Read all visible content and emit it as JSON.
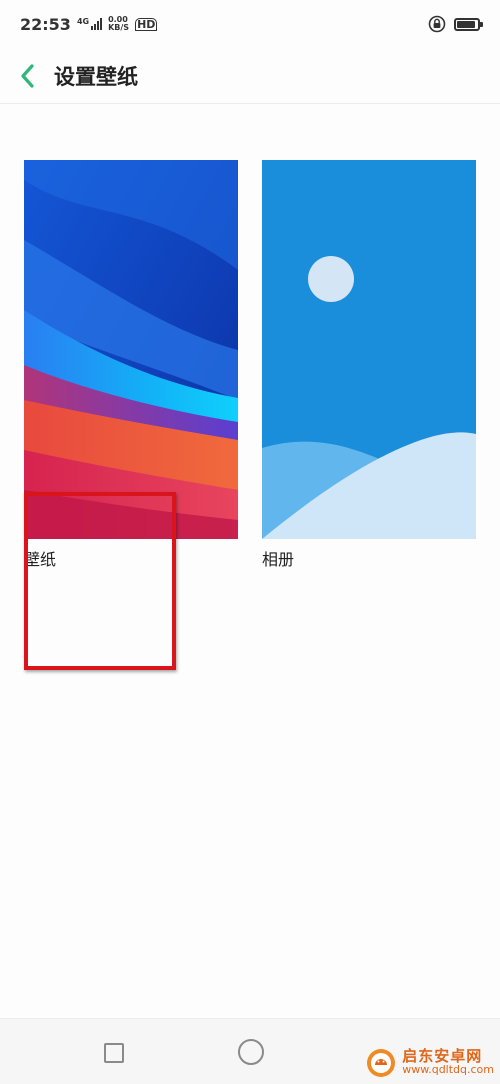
{
  "status_bar": {
    "time": "22:53",
    "network_type": "4G",
    "speed_value": "0.00",
    "speed_unit": "KB/S",
    "hd_label": "HD",
    "icons": [
      "signal-icon",
      "hd-icon",
      "rotation-lock-icon",
      "battery-icon"
    ]
  },
  "header": {
    "title": "设置壁纸",
    "back_icon": "chevron-left-icon",
    "accent_color": "#2fb77a"
  },
  "tiles": [
    {
      "label": "壁纸"
    },
    {
      "label": "相册"
    }
  ],
  "highlight": {
    "color": "#d9141a"
  },
  "navigation": {
    "icons": [
      "recent-apps-icon",
      "home-icon"
    ]
  },
  "watermark": {
    "name": "启东安卓网",
    "url": "www.qdltdq.com",
    "color": "#e0661a"
  }
}
